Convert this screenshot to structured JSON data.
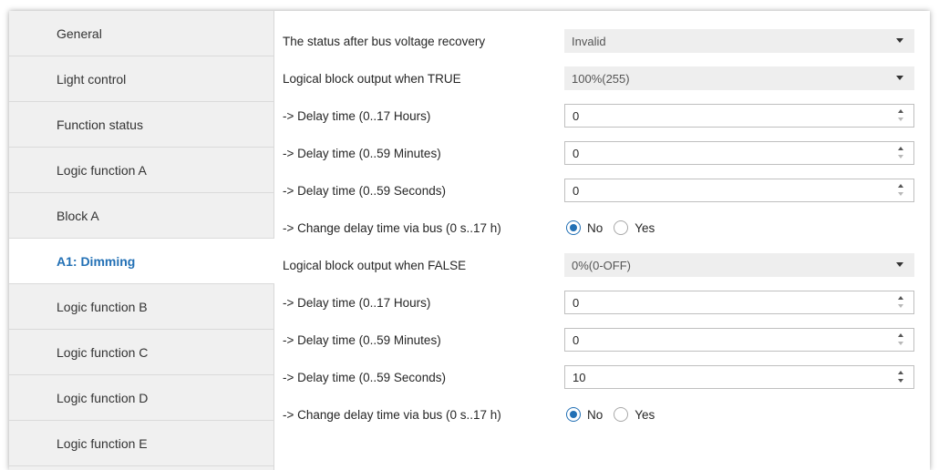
{
  "sidebar": {
    "items": [
      {
        "label": "General"
      },
      {
        "label": "Light control"
      },
      {
        "label": "Function status"
      },
      {
        "label": "Logic function A"
      },
      {
        "label": "Block A"
      },
      {
        "label": "A1: Dimming",
        "active": true
      },
      {
        "label": "Logic function B"
      },
      {
        "label": "Logic function C"
      },
      {
        "label": "Logic function D"
      },
      {
        "label": "Logic function E"
      }
    ]
  },
  "colors": {
    "accent": "#2270b5",
    "sidebar_bg": "#f0f0f0",
    "select_bg": "#eeeeee"
  },
  "params": {
    "status_recovery": {
      "label": "The status after bus voltage recovery",
      "value": "Invalid"
    },
    "true_output": {
      "label": "Logical block output when TRUE",
      "value": "100%(255)"
    },
    "true_delay_hours": {
      "label": "-> Delay time (0..17 Hours)",
      "value": "0"
    },
    "true_delay_minutes": {
      "label": "-> Delay time (0..59 Minutes)",
      "value": "0"
    },
    "true_delay_seconds": {
      "label": "-> Delay time (0..59 Seconds)",
      "value": "0"
    },
    "true_change_delay": {
      "label": "-> Change delay time via bus (0 s..17 h)",
      "options": [
        "No",
        "Yes"
      ],
      "selected": "No"
    },
    "false_output": {
      "label": "Logical block output when FALSE",
      "value": "0%(0-OFF)"
    },
    "false_delay_hours": {
      "label": "-> Delay time (0..17 Hours)",
      "value": "0"
    },
    "false_delay_minutes": {
      "label": "-> Delay time (0..59 Minutes)",
      "value": "0"
    },
    "false_delay_seconds": {
      "label": "-> Delay time (0..59 Seconds)",
      "value": "10"
    },
    "false_change_delay": {
      "label": "-> Change delay time via bus (0 s..17 h)",
      "options": [
        "No",
        "Yes"
      ],
      "selected": "No"
    }
  }
}
